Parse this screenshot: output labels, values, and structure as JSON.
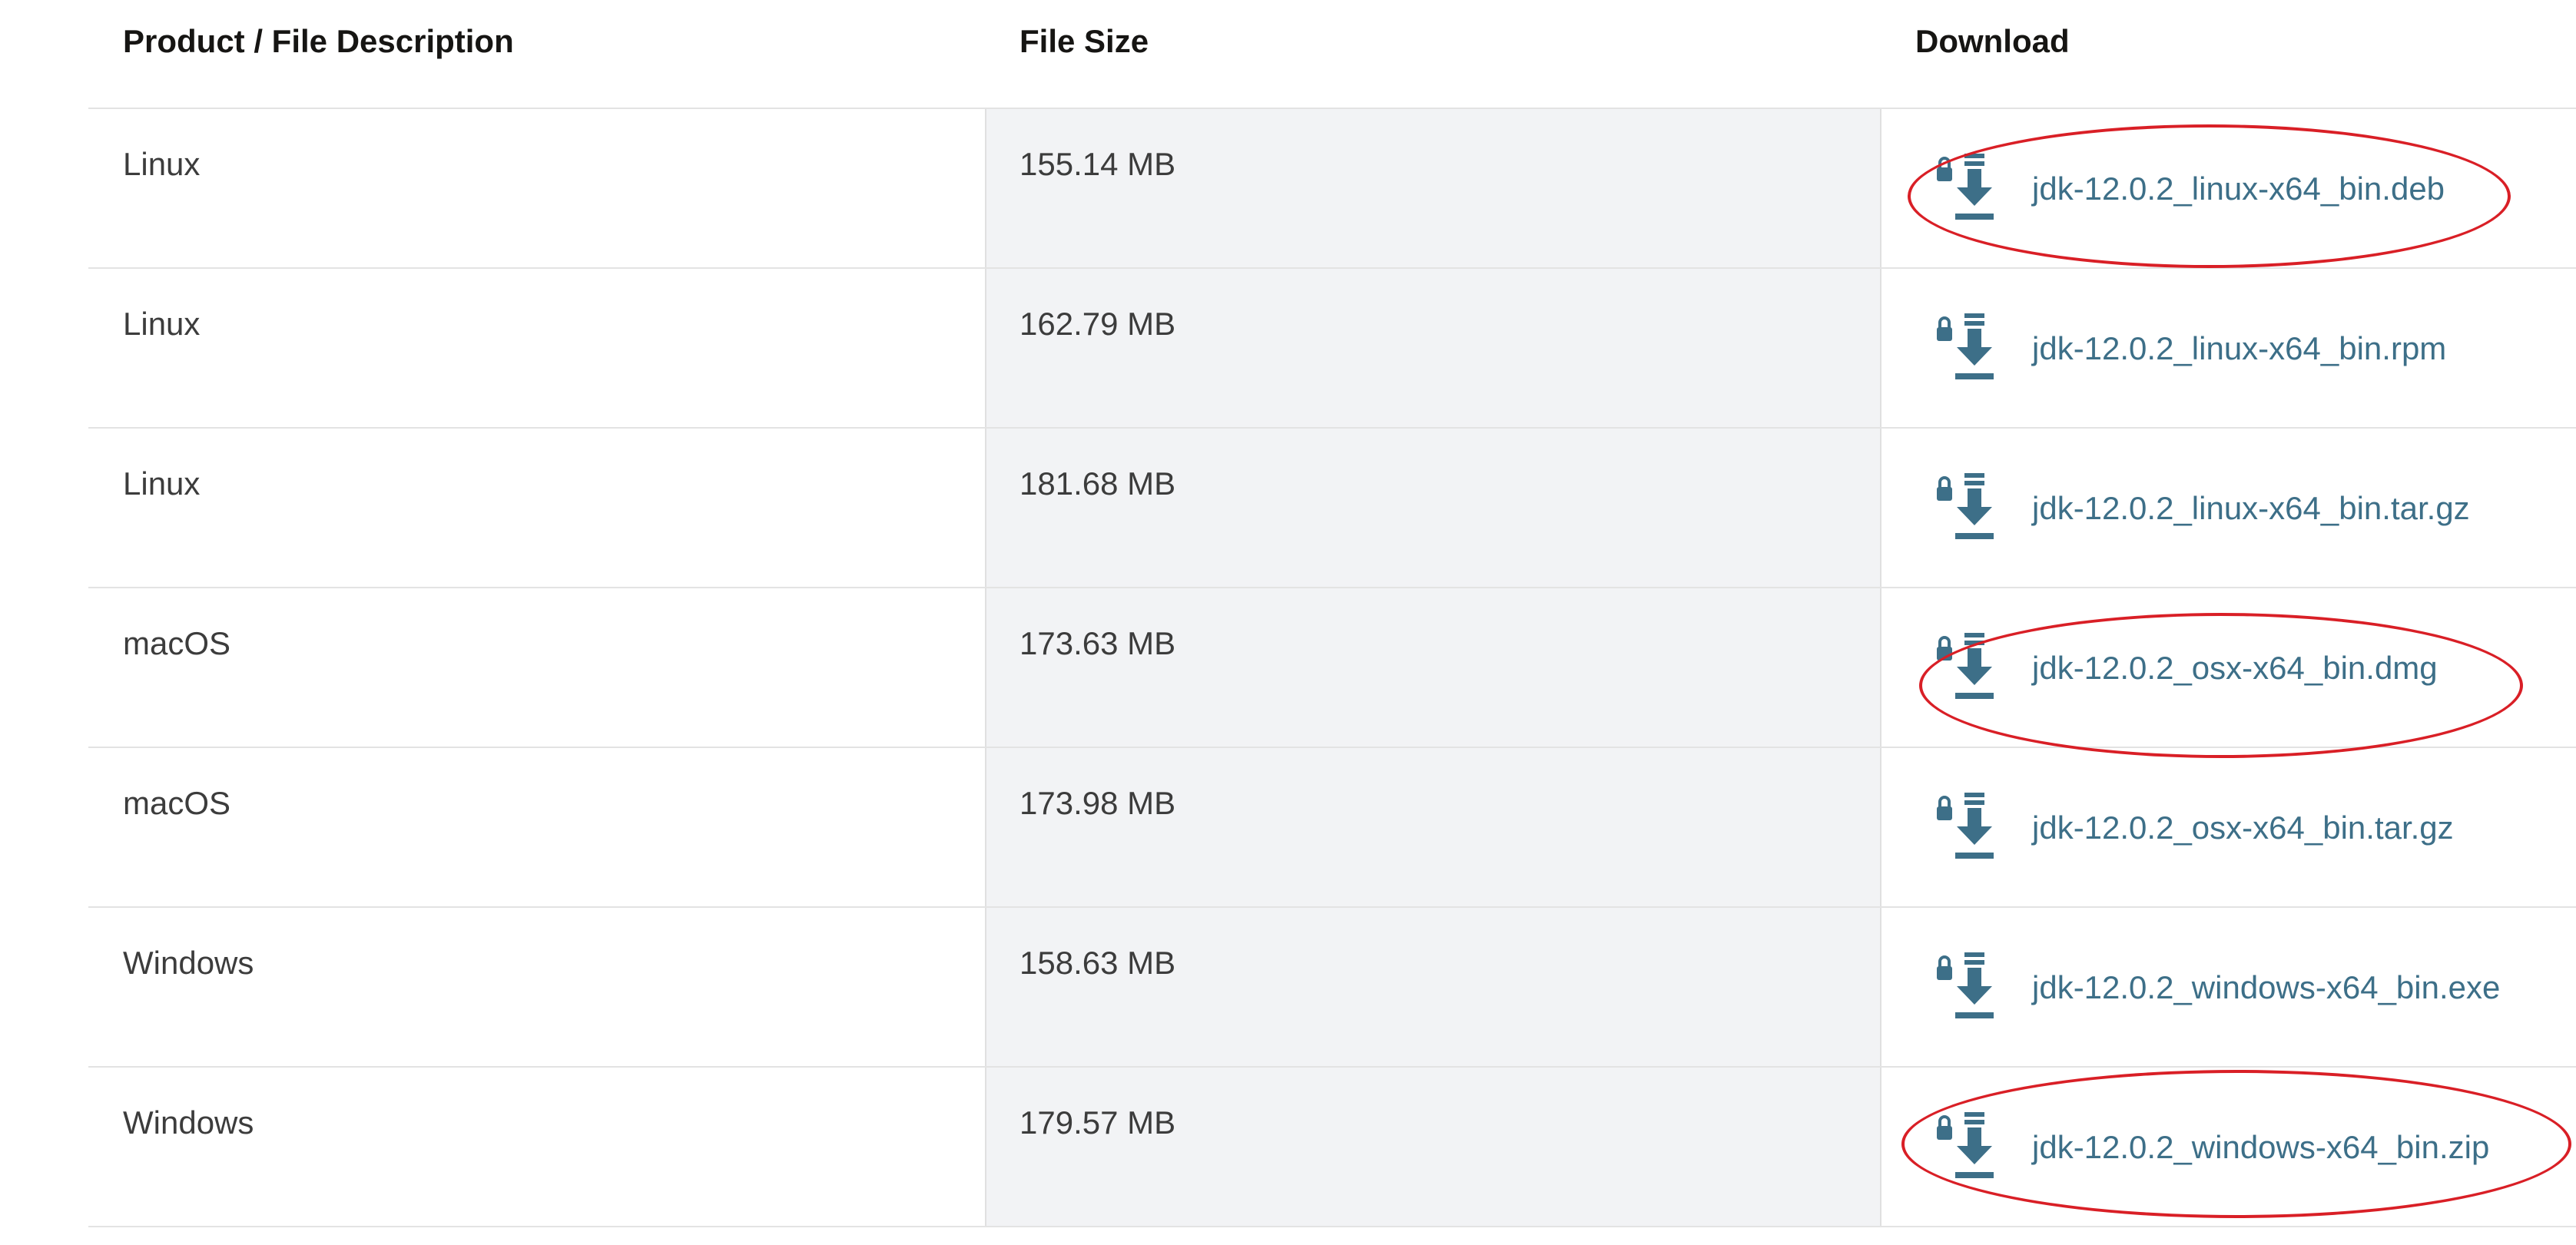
{
  "table": {
    "headers": {
      "description": "Product / File Description",
      "size": "File Size",
      "download": "Download"
    },
    "rows": [
      {
        "product": "Linux",
        "size": "155.14 MB",
        "file": "jdk-12.0.2_linux-x64_bin.deb",
        "highlighted": true
      },
      {
        "product": "Linux",
        "size": "162.79 MB",
        "file": "jdk-12.0.2_linux-x64_bin.rpm",
        "highlighted": false
      },
      {
        "product": "Linux",
        "size": "181.68 MB",
        "file": "jdk-12.0.2_linux-x64_bin.tar.gz",
        "highlighted": false
      },
      {
        "product": "macOS",
        "size": "173.63 MB",
        "file": "jdk-12.0.2_osx-x64_bin.dmg",
        "highlighted": true
      },
      {
        "product": "macOS",
        "size": "173.98 MB",
        "file": "jdk-12.0.2_osx-x64_bin.tar.gz",
        "highlighted": false
      },
      {
        "product": "Windows",
        "size": "158.63 MB",
        "file": "jdk-12.0.2_windows-x64_bin.exe",
        "highlighted": false
      },
      {
        "product": "Windows",
        "size": "179.57 MB",
        "file": "jdk-12.0.2_windows-x64_bin.zip",
        "highlighted": true
      }
    ]
  },
  "icons": {
    "download": "lock-download-icon"
  },
  "colors": {
    "link": "#3d6f88",
    "icon": "#3d6f88",
    "highlight_circle": "#d91f26",
    "size_column_bg": "#f2f3f5"
  }
}
